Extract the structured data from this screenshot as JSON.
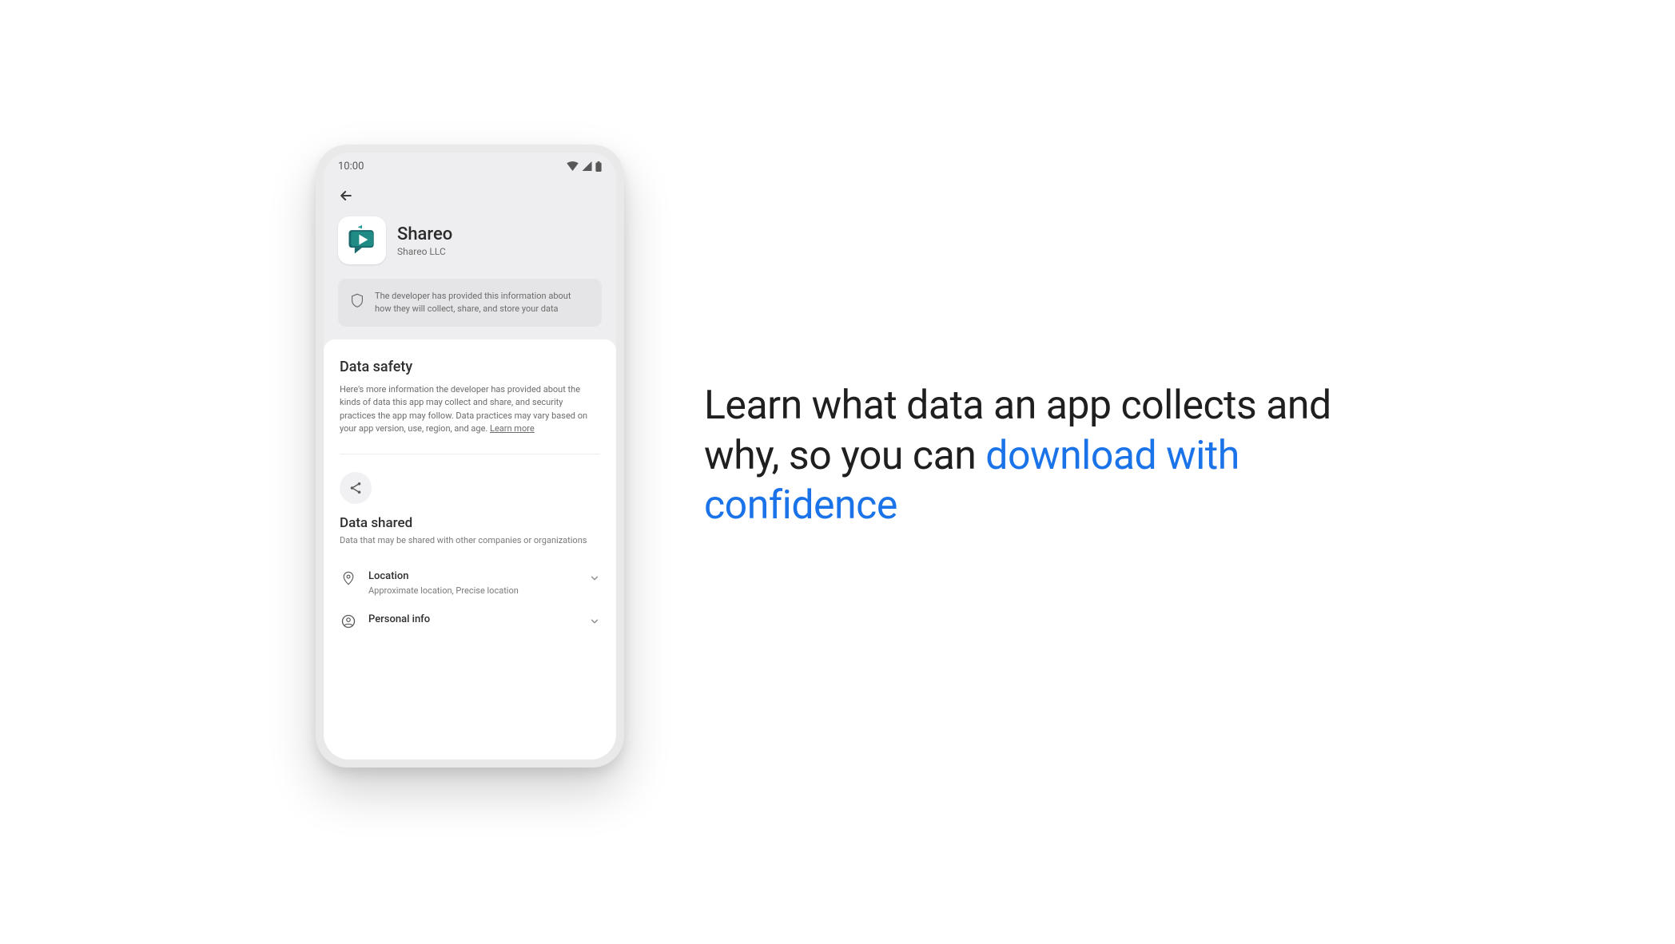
{
  "status": {
    "time": "10:00"
  },
  "app": {
    "name": "Shareo",
    "publisher": "Shareo LLC",
    "icon_name": "shareo-app-icon"
  },
  "developer_note": "The developer has provided this information about how they will collect, share, and store your data",
  "data_safety": {
    "title": "Data safety",
    "description": "Here's more information the developer has provided about the kinds of data this app may collect and share, and security practices the app may follow. Data practices may vary based on your app version, use, region, and age. ",
    "learn_more_label": "Learn more"
  },
  "data_shared": {
    "title": "Data shared",
    "subtitle": "Data that may be shared with other companies or organizations",
    "items": [
      {
        "label": "Location",
        "detail": "Approximate location, Precise location",
        "icon": "location-pin-icon"
      },
      {
        "label": "Personal info",
        "detail": "",
        "icon": "person-circle-icon"
      }
    ]
  },
  "headline": {
    "line1": "Learn what data an app collects and why, so you can ",
    "accent": "download with confidence"
  },
  "colors": {
    "accent": "#1a73e8",
    "brand_teal": "#17676b"
  }
}
